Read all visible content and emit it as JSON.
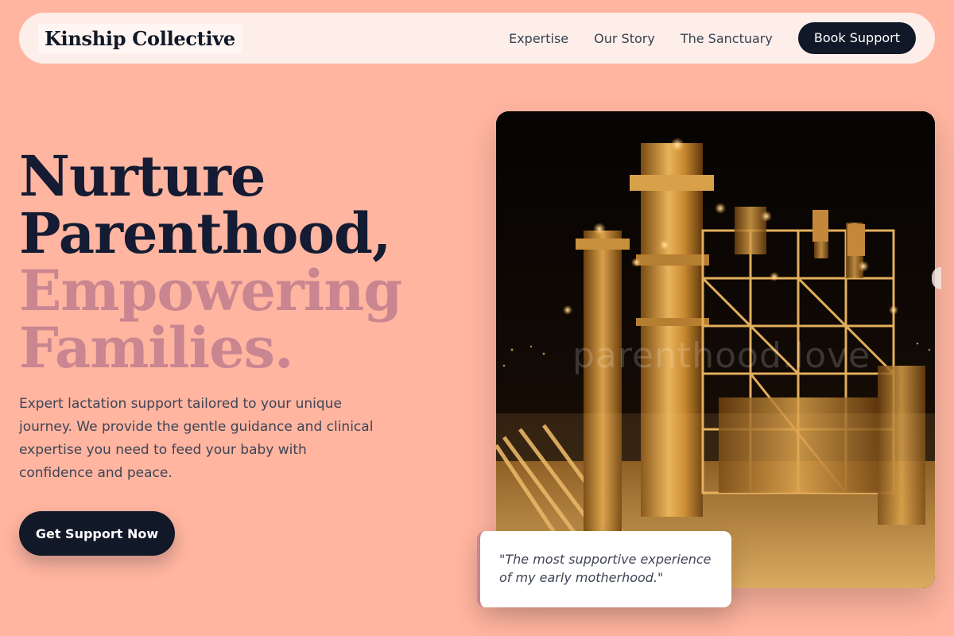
{
  "brand": {
    "name": "Kinship Collective"
  },
  "nav": {
    "links": [
      {
        "label": "Expertise"
      },
      {
        "label": "Our Story"
      },
      {
        "label": "The Sanctuary"
      }
    ],
    "cta_label": "Book Support"
  },
  "hero": {
    "headline_line1": "Nurture",
    "headline_line2": "Parenthood,",
    "headline_line3": "Empowering",
    "headline_line4": "Families.",
    "lead": "Expert lactation support tailored to your unique journey. We provide the gentle guidance and clinical expertise you need to feed your baby with confidence and peace.",
    "cta_label": "Get Support Now",
    "image_watermark": "parenthood.love"
  },
  "testimonial": {
    "quote": "\"The most supportive experience of my early motherhood.\""
  },
  "colors": {
    "background": "#FFB5A0",
    "nav_background": "#FDEEEA",
    "primary_dark": "#111827",
    "headline_dark": "#141B33",
    "headline_muted": "#C98690",
    "body_text": "#3F4456"
  },
  "icons": {
    "image_subject": "industrial-plant-night-photo"
  }
}
